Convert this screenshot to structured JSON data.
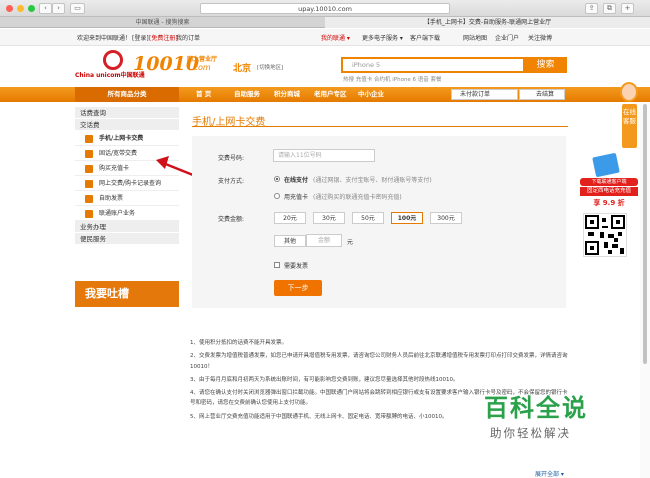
{
  "browser": {
    "url": "upay.10010.com",
    "tabs": [
      "中国联通 - 搜狗搜索",
      "【手机_上网卡】交费-自助服务-联通网上营业厅"
    ]
  },
  "topbar": {
    "welcome": "欢迎来到中国联通！",
    "login": "[登录]",
    "register": "[免费注册]",
    "my_orders": "我的订单",
    "my_unicom": "我的联通 ▾",
    "more_products": "更多电子服务 ▾",
    "client_download": "客户端下载",
    "site_map": "网站地图",
    "enterprise": "企业门户",
    "follow_weibo": "关注微博"
  },
  "header": {
    "logo_china_unicom": "China unicom中国联通",
    "logo_number": "10010",
    "logo_com": ".com",
    "logo_sub": "网上营业厅",
    "city": "北京",
    "city_switch": "[切换地区]",
    "search_placeholder": "iPhone 5",
    "search_button": "搜索",
    "hot": "热搜  充值卡  合约机  iPhone 6  语音  套餐"
  },
  "nav": {
    "all_categories": "所有商品分类",
    "items": [
      "首 页",
      "自助服务",
      "积分商城",
      "老用户专区",
      "中小企业"
    ],
    "unpaid_orders": "未付款订单",
    "cart": "去结算"
  },
  "sidebar": {
    "sections": [
      {
        "title": "话费查询",
        "items": []
      },
      {
        "title": "交话费",
        "items": [
          "手机/上网卡交费",
          "固话/宽带交费",
          "购买充值卡",
          "网上交费/购卡记录查询",
          "自助发票",
          "联通账户业务"
        ]
      },
      {
        "title": "业务办理",
        "items": []
      },
      {
        "title": "便民服务",
        "items": []
      }
    ],
    "complain": "我要吐槽"
  },
  "form": {
    "title": "手机/上网卡交费",
    "phone_label": "交费号码:",
    "phone_placeholder": "请输入11位号码",
    "pay_label": "支付方式:",
    "online_pay": "在线支付",
    "online_desc": "(通过网银、支付宝账号、财付通账号等支付)",
    "card_pay": "用充值卡",
    "card_desc": "(通过购买的联通充值卡密码充值)",
    "amount_label": "交费金额:",
    "amounts": [
      "20元",
      "30元",
      "50元",
      "100元",
      "300元"
    ],
    "selected_amount": "100元",
    "other": "其他",
    "amount_placeholder": "金额",
    "yuan": "元",
    "invoice": "需要发票",
    "next": "下一步"
  },
  "notes": [
    "1、使用积分抵扣的话费不能开具发票。",
    "2、交费发票为增值税普通发票，如您已申请开具增值税专用发票，请咨询您公司财务人员后前往北京联通增值税专用发票打印点打印交费发票，详情请咨询10010！",
    "3、由于每月月底和月初两天为系统出账时间，有可能影响您交费到账，建议您尽量选择其他时段热线10010。",
    "4、请您在确认支付时关闭浏览器弹出窗口拦截功能。中国联通门户网站将会跳转到相应银行或支有设置要求客户输入银行卡号及密码，不会保留您的银行卡号和密码，请您在交费前确认您使用上支付功能。",
    "5、网上营业厅交费充值功能适用于中国联通手机、无线上网卡、固定电话、宽带额膊的电话、小10010。"
  ],
  "more": "展开全部 ▾",
  "right": {
    "service": "在线客服",
    "promo1": "下载联通客户端",
    "promo2": "固定西电话充充值",
    "promo3": "享 9.9 折"
  },
  "watermark": {
    "big": "百科全说",
    "small": "助你轻松解决"
  }
}
